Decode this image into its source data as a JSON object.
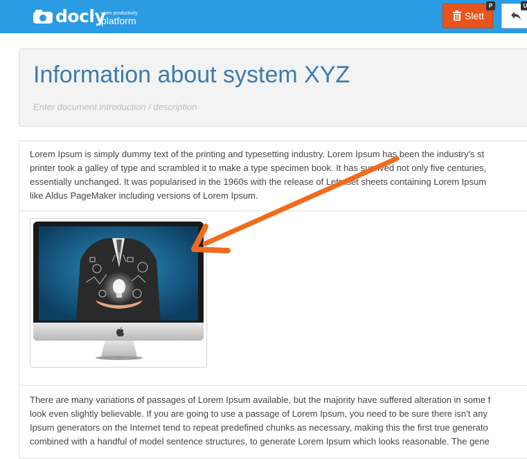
{
  "app": {
    "logo_text": "docly",
    "logo_tagline_small": "open productivity",
    "logo_tagline": "platform"
  },
  "toolbar": {
    "delete_label": "Slett",
    "delete_shortcut": "P",
    "back_shortcut": "U"
  },
  "document": {
    "title": "Information about system XYZ",
    "description_placeholder": "Enter document introduction / description"
  },
  "content": {
    "paragraph1": [
      "Lorem Ipsum is simply dummy text of the printing and typesetting industry. Lorem Ipsum has been the industry's st",
      "printer took a galley of type and scrambled it to make a type specimen book. It has survived not only five centuries,",
      "essentially unchanged. It was popularised in the 1960s with the release of Letraset sheets containing Lorem Ipsum",
      "like Aldus PageMaker including versions of Lorem Ipsum."
    ],
    "paragraph2": [
      "There are many variations of passages of Lorem Ipsum available, but the majority have suffered alteration in some f",
      "look even slightly believable. If you are going to use a passage of Lorem Ipsum, you need to be sure there isn't any",
      "Ipsum generators on the Internet tend to repeat predefined chunks as necessary, making this the first true generato",
      "combined with a handful of model sentence structures, to generate Lorem Ipsum which looks reasonable. The gene"
    ]
  },
  "colors": {
    "topbar": "#2b9be3",
    "delete_button": "#e8541d",
    "title": "#3b7cae",
    "annotation_arrow": "#f26b1d"
  },
  "icons": [
    "cloud-icon",
    "trash-icon",
    "reply-arrow-icon",
    "apple-logo-icon"
  ]
}
